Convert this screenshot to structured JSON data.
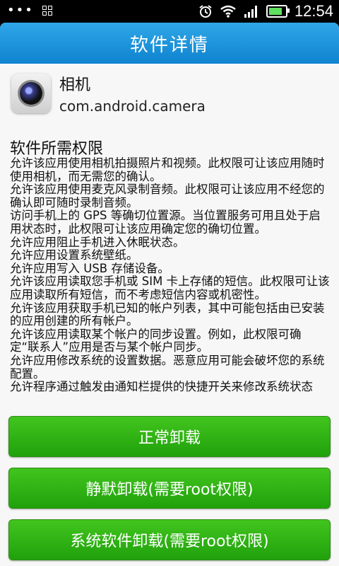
{
  "status_bar": {
    "time": "12:54",
    "icons": [
      "more-dots-icon",
      "grid-icon",
      "alarm-icon",
      "wifi-icon",
      "signal-icon",
      "battery-icon"
    ],
    "battery_level": 0.7
  },
  "dialog": {
    "title": "软件详情",
    "app": {
      "name": "相机",
      "package": "com.android.camera",
      "icon": "camera-app-icon"
    },
    "permissions_title": "软件所需权限",
    "permissions": [
      "允许该应用使用相机拍摄照片和视频。此权限可让该应用随时使用相机，而无需您的确认。",
      "允许该应用使用麦克风录制音频。此权限可让该应用不经您的确认即可随时录制音频。",
      "访问手机上的 GPS 等确切位置源。当位置服务可用且处于启用状态时，此权限可让该应用确定您的确切位置。",
      "允许应用阻止手机进入休眠状态。",
      "允许应用设置系统壁纸。",
      "允许应用写入 USB 存储设备。",
      "允许该应用读取您手机或 SIM 卡上存储的短信。此权限可让该应用读取所有短信，而不考虑短信内容或机密性。",
      "允许该应用获取手机已知的帐户列表，其中可能包括由已安装的应用创建的所有帐户。",
      "允许该应用读取某个帐户的同步设置。例如，此权限可确定“联系人”应用是否与某个帐户同步。",
      "允许应用修改系统的设置数据。恶意应用可能会破坏您的系统配置。",
      "允许程序通过触发由通知栏提供的快捷开关来修改系统状态"
    ],
    "buttons": {
      "normal": "正常卸载",
      "silent": "静默卸载(需要root权限)",
      "system": "系统软件卸载(需要root权限)"
    }
  }
}
